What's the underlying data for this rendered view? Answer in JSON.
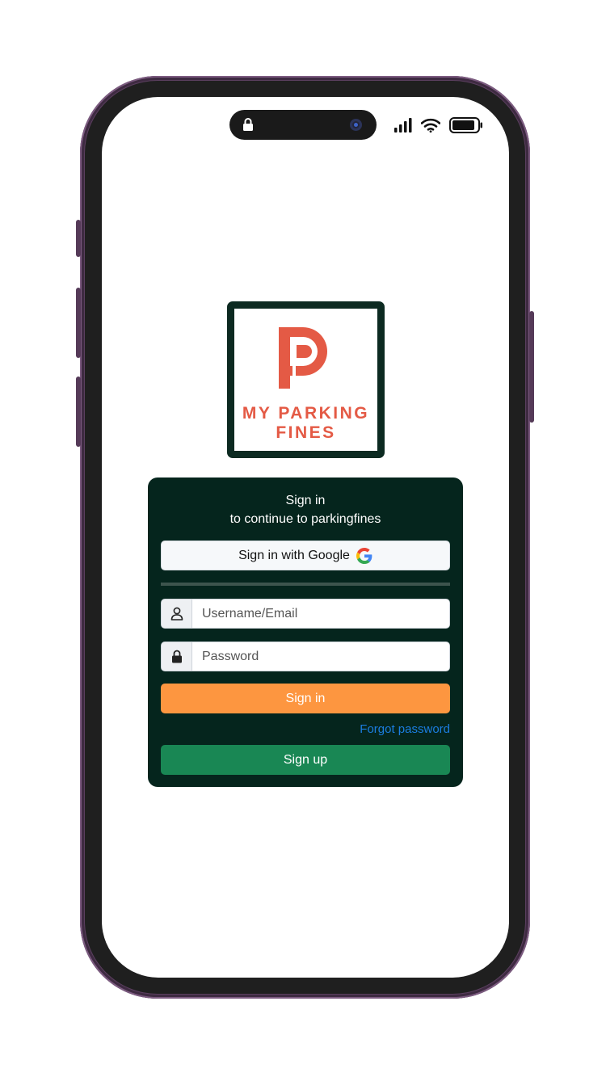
{
  "device": {
    "frame_color": "#5b3f5f",
    "bezel_color": "#1f1f1f",
    "icons": [
      "lock-icon",
      "front-camera",
      "cellular-signal-icon",
      "wifi-icon",
      "battery-icon"
    ]
  },
  "logo": {
    "line1": "MY PARKING",
    "line2": "FINES",
    "brand_color": "#e45a45",
    "border_color": "#0c2a21"
  },
  "signin_card": {
    "title": "Sign in",
    "subtitle": "to continue to parkingfines",
    "google_button_label": "Sign in with Google",
    "username_placeholder": "Username/Email",
    "password_placeholder": "Password",
    "signin_button_label": "Sign in",
    "forgot_password_label": "Forgot password",
    "signup_button_label": "Sign up",
    "colors": {
      "card_bg": "#05251d",
      "signin_btn": "#fd9640",
      "signup_btn": "#198754",
      "link": "#1b7de0"
    }
  }
}
